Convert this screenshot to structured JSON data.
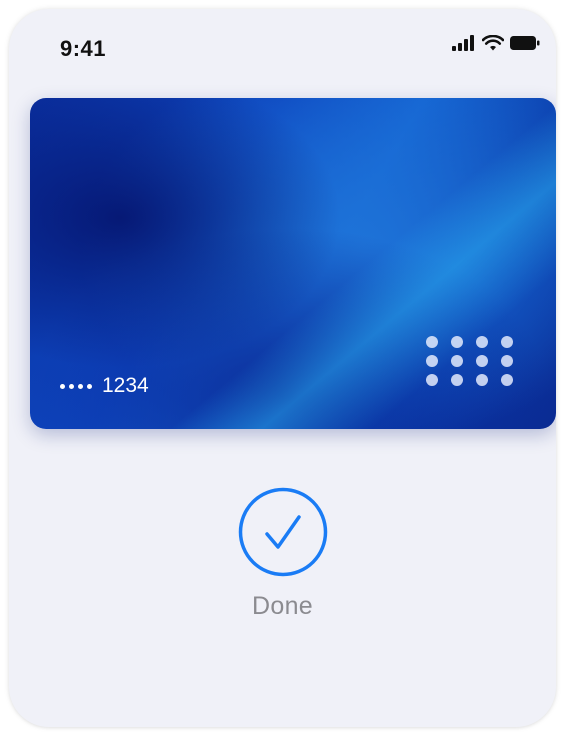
{
  "status_bar": {
    "time": "9:41",
    "icons": [
      "cellular-signal-icon",
      "wifi-icon",
      "battery-icon"
    ]
  },
  "card": {
    "masked_dots": "••••",
    "last_four": "1234",
    "icons": [
      "card-dot-grid-icon"
    ]
  },
  "confirmation": {
    "icon": "checkmark-circle-icon",
    "label": "Done"
  },
  "colors": {
    "accent": "#1a7cf5",
    "card_primary": "#0e47c0",
    "card_highlight": "#28aaf0",
    "background": "#f0f1f8",
    "label_gray": "#8b8b90"
  }
}
